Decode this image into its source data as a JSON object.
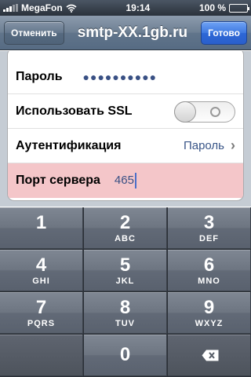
{
  "status_bar": {
    "carrier": "MegaFon",
    "time": "19:14",
    "battery": "100 %",
    "battery_level": 1.0
  },
  "nav": {
    "cancel": "Отменить",
    "title": "smtp-XX.1gb.ru",
    "done": "Готово"
  },
  "form": {
    "password": {
      "label": "Пароль",
      "masked_value": "●●●●●●●●●●"
    },
    "ssl": {
      "label": "Использовать SSL",
      "enabled": false
    },
    "auth": {
      "label": "Аутентификация",
      "value": "Пароль"
    },
    "port": {
      "label": "Порт сервера",
      "value": "465"
    }
  },
  "keypad": {
    "keys": [
      {
        "num": "1",
        "letters": ""
      },
      {
        "num": "2",
        "letters": "ABC"
      },
      {
        "num": "3",
        "letters": "DEF"
      },
      {
        "num": "4",
        "letters": "GHI"
      },
      {
        "num": "5",
        "letters": "JKL"
      },
      {
        "num": "6",
        "letters": "MNO"
      },
      {
        "num": "7",
        "letters": "PQRS"
      },
      {
        "num": "8",
        "letters": "TUV"
      },
      {
        "num": "9",
        "letters": "WXYZ"
      },
      {
        "num": "0",
        "letters": ""
      }
    ]
  },
  "colors": {
    "nav_accent": "#2d67d6",
    "field_highlight": "#f4c6c9",
    "value_blue": "#385487"
  }
}
